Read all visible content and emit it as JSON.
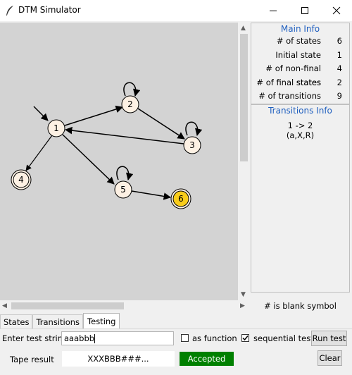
{
  "window": {
    "title": "DTM Simulator"
  },
  "main_info": {
    "title": "Main Info",
    "rows": [
      {
        "label": "# of states",
        "value": "6"
      },
      {
        "label": "Initial state",
        "value": "1"
      },
      {
        "label": "# of non-final states",
        "value": "4"
      },
      {
        "label": "# of final states",
        "value": "2"
      },
      {
        "label": "# of transitions",
        "value": "9"
      }
    ]
  },
  "transitions_info": {
    "title": "Transitions Info",
    "selected_edge": "1 -> 2",
    "selected_rule": "(a,X,R)"
  },
  "blank_note": "# is blank symbol",
  "tabs": [
    "States",
    "Transitions",
    "Testing"
  ],
  "active_tab": "Testing",
  "testing": {
    "enter_label": "Enter test string",
    "input_value": "aaabbb",
    "as_function_label": "as function",
    "as_function_checked": false,
    "sequential_label": "sequential test",
    "sequential_checked": true,
    "run_label": "Run test",
    "tape_label": "Tape result",
    "tape_value": "XXXBBB###...",
    "status": "Accepted",
    "clear_label": "Clear"
  },
  "graph": {
    "states": [
      {
        "id": "1",
        "final": false,
        "highlighted": false
      },
      {
        "id": "2",
        "final": false,
        "highlighted": false
      },
      {
        "id": "3",
        "final": false,
        "highlighted": false
      },
      {
        "id": "4",
        "final": true,
        "highlighted": false
      },
      {
        "id": "5",
        "final": false,
        "highlighted": false
      },
      {
        "id": "6",
        "final": true,
        "highlighted": true
      }
    ],
    "colors": {
      "state_fill": "#fdf1e4",
      "highlight_fill": "#f8cc1b",
      "canvas": "#d3d3d3",
      "accepted": "#008000",
      "section_title": "#1f5fbf"
    }
  }
}
